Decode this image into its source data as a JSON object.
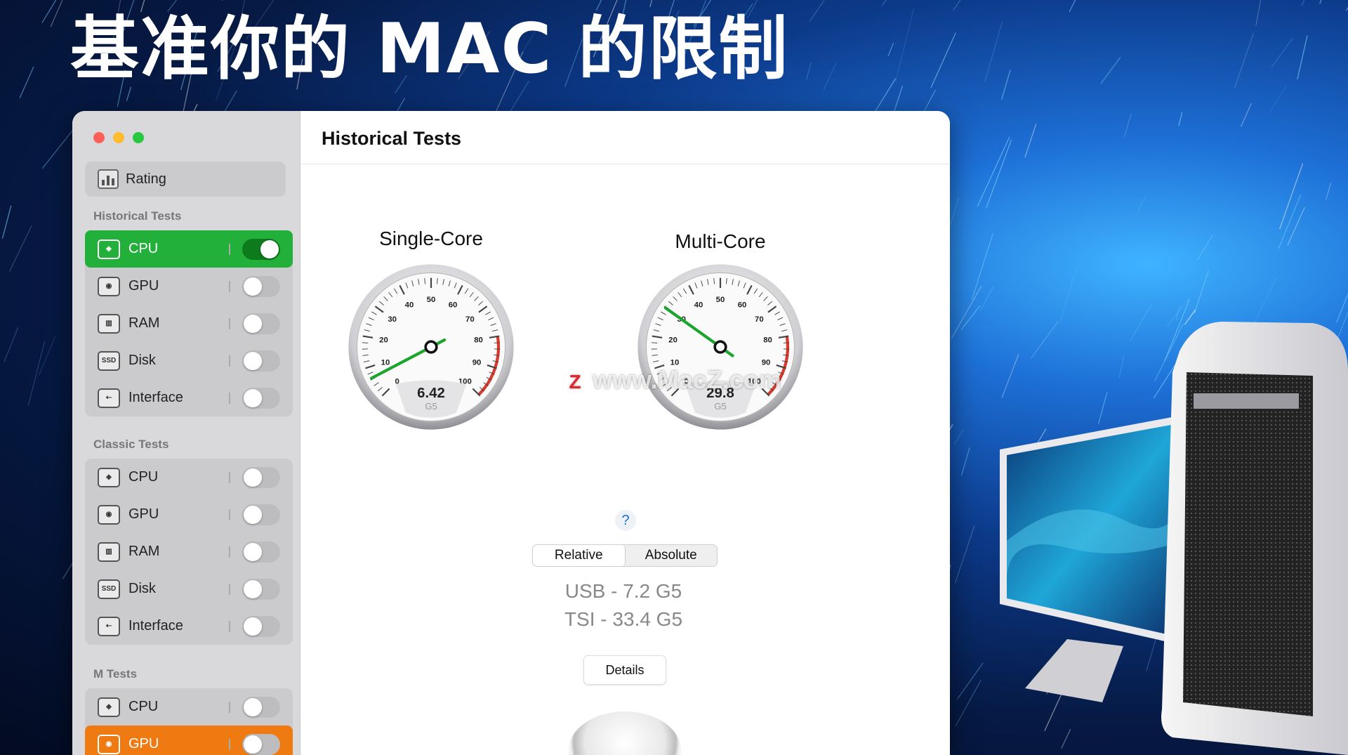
{
  "headline": "基准你的 MAC 的限制",
  "window": {
    "traffic_lights": [
      "#fe5f57",
      "#febc2e",
      "#28c840"
    ],
    "sidebar": {
      "rating_label": "Rating",
      "historical_title": "Historical Tests",
      "historical_items": [
        {
          "label": "CPU",
          "icon": "cpu-icon",
          "on": true,
          "highlight": "green"
        },
        {
          "label": "GPU",
          "icon": "gpu-icon",
          "on": false
        },
        {
          "label": "RAM",
          "icon": "ram-icon",
          "on": false
        },
        {
          "label": "Disk",
          "icon": "ssd-icon",
          "on": false
        },
        {
          "label": "Interface",
          "icon": "usb-icon",
          "on": false
        }
      ],
      "classic_title": "Classic Tests",
      "classic_items": [
        {
          "label": "CPU",
          "icon": "cpu-icon",
          "on": false
        },
        {
          "label": "GPU",
          "icon": "gpu-icon",
          "on": false
        },
        {
          "label": "RAM",
          "icon": "ram-icon",
          "on": false
        },
        {
          "label": "Disk",
          "icon": "ssd-icon",
          "on": false
        },
        {
          "label": "Interface",
          "icon": "usb-icon",
          "on": false
        }
      ],
      "m_title": "M Tests",
      "m_items": [
        {
          "label": "CPU",
          "icon": "cpu-icon",
          "on": false
        },
        {
          "label": "GPU",
          "icon": "gpu-icon",
          "on": false,
          "highlight": "orange"
        }
      ],
      "ssd_text": "SSD"
    },
    "main": {
      "title": "Historical Tests",
      "gauges": [
        {
          "title": "Single-Core",
          "value": 6.42,
          "display": "6.42",
          "unit": "G5"
        },
        {
          "title": "Multi-Core",
          "value": 29.8,
          "display": "29.8",
          "unit": "G5"
        }
      ],
      "gauge_ticks": [
        "0",
        "10",
        "20",
        "30",
        "40",
        "50",
        "60",
        "70",
        "80",
        "90",
        "100"
      ],
      "help": "?",
      "segments": [
        "Relative",
        "Absolute"
      ],
      "segment_active": "Relative",
      "stats": [
        "USB - 7.2 G5",
        "TSI - 33.4 G5"
      ],
      "details_label": "Details"
    }
  },
  "watermark": {
    "logo": "Z",
    "text": "www.MacZ.com"
  },
  "colors": {
    "accent_green": "#22b03a",
    "accent_orange": "#f07a12",
    "needle": "#1aa52d",
    "redzone": "#d9382b"
  }
}
